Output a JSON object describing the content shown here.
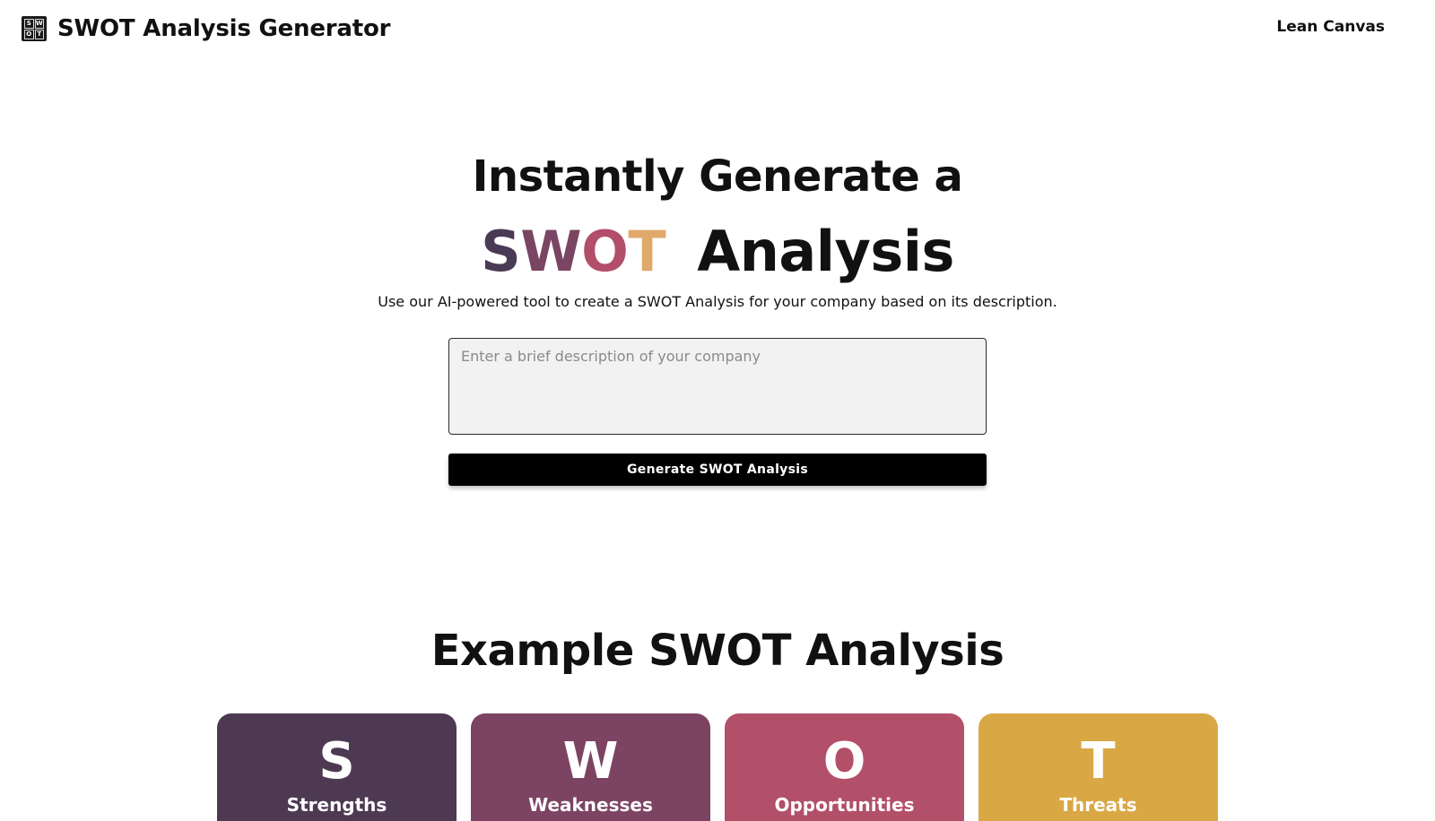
{
  "header": {
    "logo_letters": [
      "S",
      "W",
      "O",
      "T"
    ],
    "title": "SWOT Analysis Generator",
    "nav_link": "Lean Canvas"
  },
  "hero": {
    "line1": "Instantly Generate a",
    "swot_letters": [
      {
        "char": "S",
        "color": "#4a3a55"
      },
      {
        "char": "W",
        "color": "#7a4563"
      },
      {
        "char": "O",
        "color": "#b24e6a"
      },
      {
        "char": "T",
        "color": "#e0a96a"
      }
    ],
    "analysis_word": "Analysis",
    "subtitle": "Use our AI-powered tool to create a SWOT Analysis for your company based on its description."
  },
  "form": {
    "description_value": "",
    "description_placeholder": "Enter a brief description of your company",
    "submit_label": "Generate SWOT Analysis"
  },
  "example": {
    "title": "Example SWOT Analysis",
    "cards": [
      {
        "letter": "S",
        "label": "Strengths",
        "color": "#4d3a52"
      },
      {
        "letter": "W",
        "label": "Weaknesses",
        "color": "#7c4462"
      },
      {
        "letter": "O",
        "label": "Opportunities",
        "color": "#b24f69"
      },
      {
        "letter": "T",
        "label": "Threats",
        "color": "#d9a845"
      }
    ]
  }
}
